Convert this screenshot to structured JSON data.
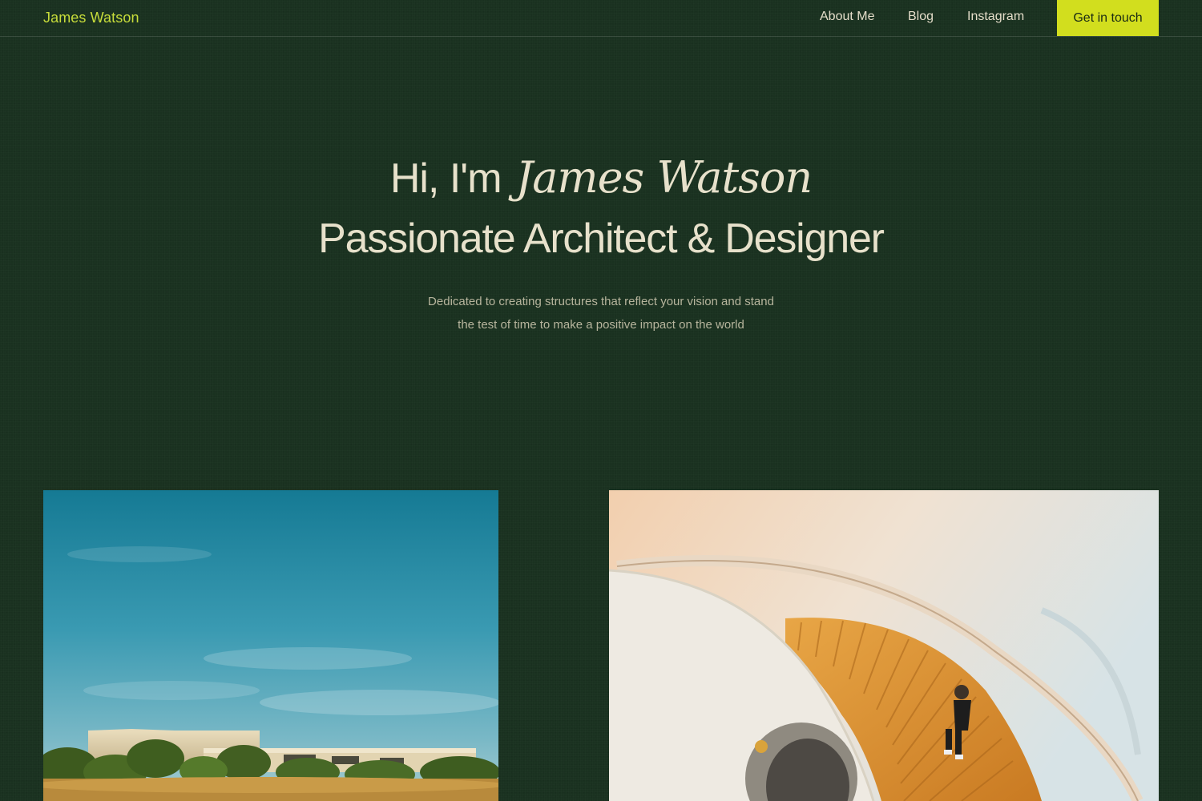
{
  "nav": {
    "brand": "James Watson",
    "links": [
      {
        "label": "About Me"
      },
      {
        "label": "Blog"
      },
      {
        "label": "Instagram"
      }
    ],
    "cta_label": "Get in touch"
  },
  "hero": {
    "greeting": "Hi, I'm",
    "name": "James Watson",
    "headline": "Passionate Architect & Designer",
    "subtitle": "Dedicated to creating structures that reflect your vision and stand\nthe test of time to make a positive impact on the world"
  },
  "colors": {
    "background": "#1a3120",
    "accent": "#d2de1e",
    "brand_text": "#c7dc3a",
    "heading_text": "#e7e1cb",
    "muted_text": "#b7b59d"
  }
}
